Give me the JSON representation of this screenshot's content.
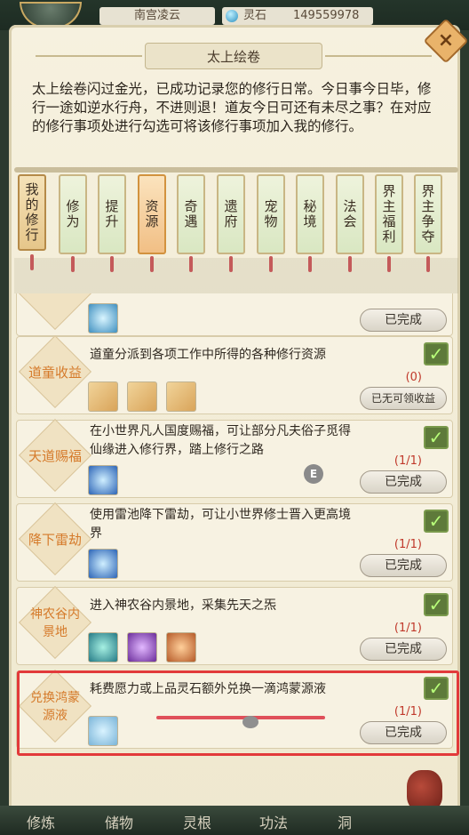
{
  "header": {
    "player_name": "南宫凌云",
    "stone_label": "灵石",
    "stone_value": "149559978"
  },
  "panel": {
    "title": "太上绘卷",
    "intro": "太上绘卷闪过金光，已成功记录您的修行日常。今日事今日毕，修行一途如逆水行舟，不进则退！道友今日可还有未尽之事？在对应的修行事项处进行勾选可将该修行事项加入我的修行。",
    "close_label": "×"
  },
  "tabs": [
    {
      "label": "我的修行"
    },
    {
      "label": "修为"
    },
    {
      "label": "提升"
    },
    {
      "label": "资源"
    },
    {
      "label": "奇遇"
    },
    {
      "label": "遗府"
    },
    {
      "label": "宠物"
    },
    {
      "label": "秘境"
    },
    {
      "label": "法会"
    },
    {
      "label": "界主福利"
    },
    {
      "label": "界主争夺"
    }
  ],
  "tasks": [
    {
      "badge": "",
      "desc": "",
      "progress": "",
      "button": "已完成"
    },
    {
      "badge": "道童收益",
      "desc": "道童分派到各项工作中所得的各种修行资源",
      "progress": "(0)",
      "button": "已无可领收益"
    },
    {
      "badge": "天道赐福",
      "desc": "在小世界凡人国度赐福，可让部分凡夫俗子觅得仙缘进入修行界，踏上修行之路",
      "progress": "(1/1)",
      "button": "已完成"
    },
    {
      "badge": "降下雷劫",
      "desc": "使用雷池降下雷劫，可让小世界修士晋入更高境界",
      "progress": "(1/1)",
      "button": "已完成"
    },
    {
      "badge": "神农谷内景地",
      "desc": "进入神农谷内景地，采集先天之炁",
      "progress": "(1/1)",
      "button": "已完成"
    },
    {
      "badge": "兑换鸿蒙源液",
      "desc": "耗费愿力或上品灵石额外兑换一滴鸿蒙源液",
      "progress": "(1/1)",
      "button": "已完成"
    }
  ],
  "check_mark": "✓",
  "marker_e": "E",
  "bottom_nav": [
    "修炼",
    "储物",
    "灵根",
    "功法",
    "洞"
  ]
}
